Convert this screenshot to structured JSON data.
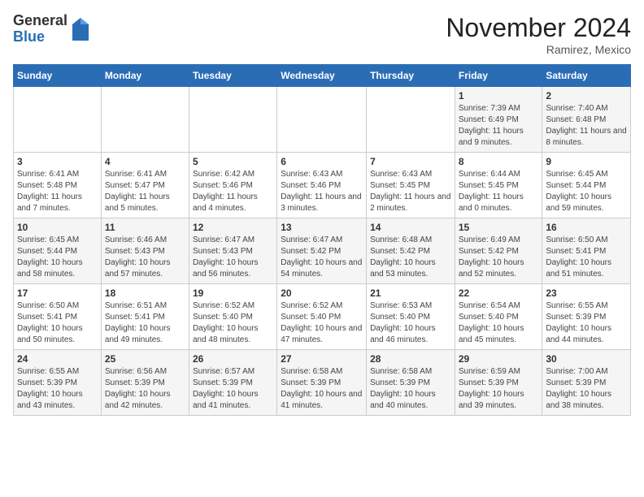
{
  "logo": {
    "general": "General",
    "blue": "Blue"
  },
  "header": {
    "month": "November 2024",
    "location": "Ramirez, Mexico"
  },
  "days_of_week": [
    "Sunday",
    "Monday",
    "Tuesday",
    "Wednesday",
    "Thursday",
    "Friday",
    "Saturday"
  ],
  "weeks": [
    [
      {
        "day": "",
        "detail": ""
      },
      {
        "day": "",
        "detail": ""
      },
      {
        "day": "",
        "detail": ""
      },
      {
        "day": "",
        "detail": ""
      },
      {
        "day": "",
        "detail": ""
      },
      {
        "day": "1",
        "detail": "Sunrise: 7:39 AM\nSunset: 6:49 PM\nDaylight: 11 hours and 9 minutes."
      },
      {
        "day": "2",
        "detail": "Sunrise: 7:40 AM\nSunset: 6:48 PM\nDaylight: 11 hours and 8 minutes."
      }
    ],
    [
      {
        "day": "3",
        "detail": "Sunrise: 6:41 AM\nSunset: 5:48 PM\nDaylight: 11 hours and 7 minutes."
      },
      {
        "day": "4",
        "detail": "Sunrise: 6:41 AM\nSunset: 5:47 PM\nDaylight: 11 hours and 5 minutes."
      },
      {
        "day": "5",
        "detail": "Sunrise: 6:42 AM\nSunset: 5:46 PM\nDaylight: 11 hours and 4 minutes."
      },
      {
        "day": "6",
        "detail": "Sunrise: 6:43 AM\nSunset: 5:46 PM\nDaylight: 11 hours and 3 minutes."
      },
      {
        "day": "7",
        "detail": "Sunrise: 6:43 AM\nSunset: 5:45 PM\nDaylight: 11 hours and 2 minutes."
      },
      {
        "day": "8",
        "detail": "Sunrise: 6:44 AM\nSunset: 5:45 PM\nDaylight: 11 hours and 0 minutes."
      },
      {
        "day": "9",
        "detail": "Sunrise: 6:45 AM\nSunset: 5:44 PM\nDaylight: 10 hours and 59 minutes."
      }
    ],
    [
      {
        "day": "10",
        "detail": "Sunrise: 6:45 AM\nSunset: 5:44 PM\nDaylight: 10 hours and 58 minutes."
      },
      {
        "day": "11",
        "detail": "Sunrise: 6:46 AM\nSunset: 5:43 PM\nDaylight: 10 hours and 57 minutes."
      },
      {
        "day": "12",
        "detail": "Sunrise: 6:47 AM\nSunset: 5:43 PM\nDaylight: 10 hours and 56 minutes."
      },
      {
        "day": "13",
        "detail": "Sunrise: 6:47 AM\nSunset: 5:42 PM\nDaylight: 10 hours and 54 minutes."
      },
      {
        "day": "14",
        "detail": "Sunrise: 6:48 AM\nSunset: 5:42 PM\nDaylight: 10 hours and 53 minutes."
      },
      {
        "day": "15",
        "detail": "Sunrise: 6:49 AM\nSunset: 5:42 PM\nDaylight: 10 hours and 52 minutes."
      },
      {
        "day": "16",
        "detail": "Sunrise: 6:50 AM\nSunset: 5:41 PM\nDaylight: 10 hours and 51 minutes."
      }
    ],
    [
      {
        "day": "17",
        "detail": "Sunrise: 6:50 AM\nSunset: 5:41 PM\nDaylight: 10 hours and 50 minutes."
      },
      {
        "day": "18",
        "detail": "Sunrise: 6:51 AM\nSunset: 5:41 PM\nDaylight: 10 hours and 49 minutes."
      },
      {
        "day": "19",
        "detail": "Sunrise: 6:52 AM\nSunset: 5:40 PM\nDaylight: 10 hours and 48 minutes."
      },
      {
        "day": "20",
        "detail": "Sunrise: 6:52 AM\nSunset: 5:40 PM\nDaylight: 10 hours and 47 minutes."
      },
      {
        "day": "21",
        "detail": "Sunrise: 6:53 AM\nSunset: 5:40 PM\nDaylight: 10 hours and 46 minutes."
      },
      {
        "day": "22",
        "detail": "Sunrise: 6:54 AM\nSunset: 5:40 PM\nDaylight: 10 hours and 45 minutes."
      },
      {
        "day": "23",
        "detail": "Sunrise: 6:55 AM\nSunset: 5:39 PM\nDaylight: 10 hours and 44 minutes."
      }
    ],
    [
      {
        "day": "24",
        "detail": "Sunrise: 6:55 AM\nSunset: 5:39 PM\nDaylight: 10 hours and 43 minutes."
      },
      {
        "day": "25",
        "detail": "Sunrise: 6:56 AM\nSunset: 5:39 PM\nDaylight: 10 hours and 42 minutes."
      },
      {
        "day": "26",
        "detail": "Sunrise: 6:57 AM\nSunset: 5:39 PM\nDaylight: 10 hours and 41 minutes."
      },
      {
        "day": "27",
        "detail": "Sunrise: 6:58 AM\nSunset: 5:39 PM\nDaylight: 10 hours and 41 minutes."
      },
      {
        "day": "28",
        "detail": "Sunrise: 6:58 AM\nSunset: 5:39 PM\nDaylight: 10 hours and 40 minutes."
      },
      {
        "day": "29",
        "detail": "Sunrise: 6:59 AM\nSunset: 5:39 PM\nDaylight: 10 hours and 39 minutes."
      },
      {
        "day": "30",
        "detail": "Sunrise: 7:00 AM\nSunset: 5:39 PM\nDaylight: 10 hours and 38 minutes."
      }
    ]
  ]
}
